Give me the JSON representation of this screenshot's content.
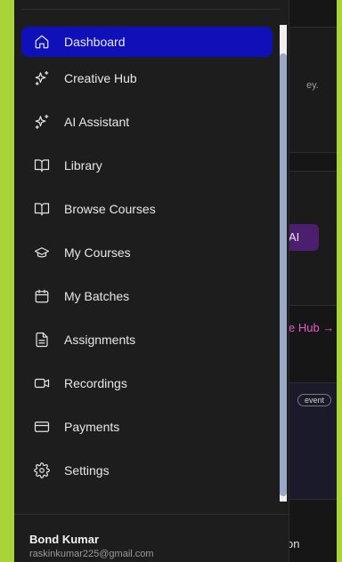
{
  "background": {
    "fragments": {
      "ey": "ey.",
      "ai": "AI",
      "hub": "e Hub →",
      "event": "event",
      "on": "on"
    }
  },
  "sidebar": {
    "items": [
      {
        "label": "Dashboard",
        "icon": "home-icon",
        "active": true
      },
      {
        "label": "Creative Hub",
        "icon": "sparkles-icon"
      },
      {
        "label": "AI Assistant",
        "icon": "sparkles-icon"
      },
      {
        "label": "Library",
        "icon": "book-open-icon"
      },
      {
        "label": "Browse Courses",
        "icon": "book-open-icon"
      },
      {
        "label": "My Courses",
        "icon": "graduation-cap-icon"
      },
      {
        "label": "My Batches",
        "icon": "calendar-icon"
      },
      {
        "label": "Assignments",
        "icon": "file-text-icon"
      },
      {
        "label": "Recordings",
        "icon": "video-icon"
      },
      {
        "label": "Payments",
        "icon": "credit-card-icon"
      },
      {
        "label": "Settings",
        "icon": "gear-icon"
      }
    ]
  },
  "user": {
    "name": "Bond Kumar",
    "email": "raskinkumar225@gmail.com"
  },
  "colors": {
    "active": "#1010b8",
    "background": "#161616",
    "frame": "#a8d43a"
  }
}
